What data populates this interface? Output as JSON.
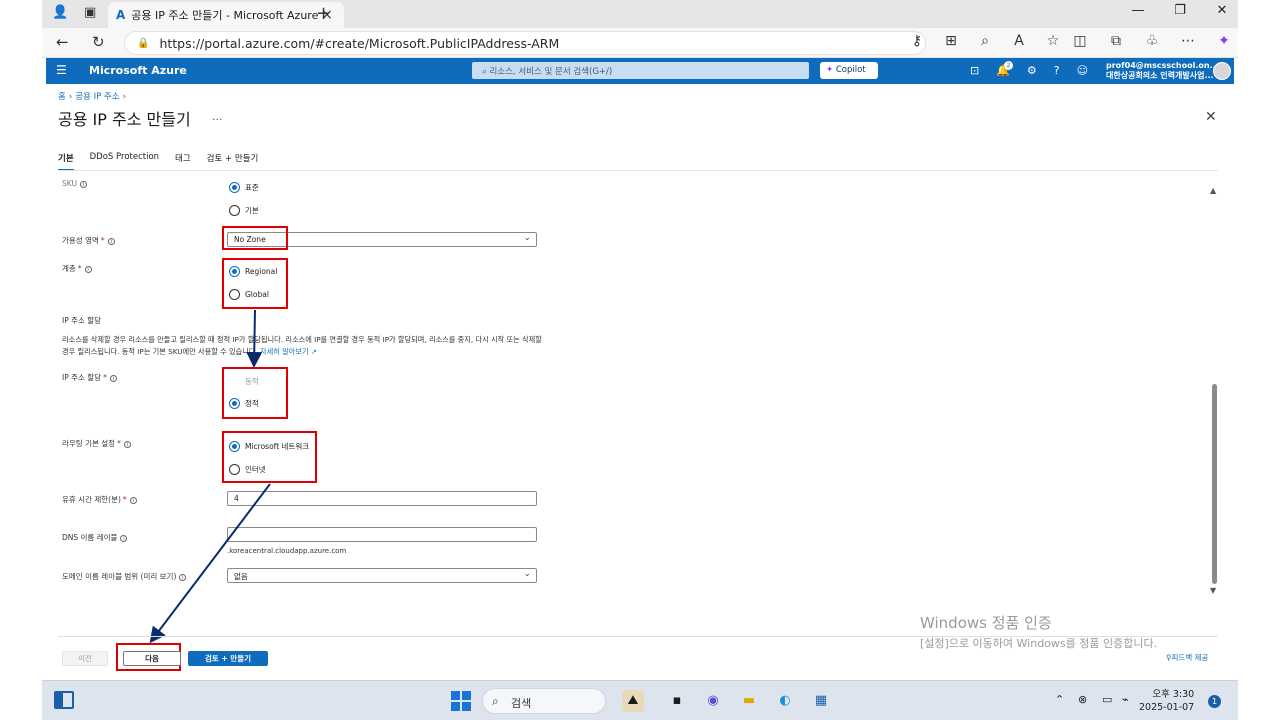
{
  "browser": {
    "tab_title": "공용 IP 주소 만들기 - Microsoft Azure",
    "url": "https://portal.azure.com/#create/Microsoft.PublicIPAddress-ARM"
  },
  "azure": {
    "brand": "Microsoft Azure",
    "search_placeholder": "리소스, 서비스 및 문서 검색(G+/)",
    "copilot": "Copilot",
    "notif_count": "2",
    "user_email": "prof04@mscsschool.on...",
    "user_org": "대한상공회의소 인력개발사업..."
  },
  "page": {
    "breadcrumb": [
      "홈",
      "공용 IP 주소"
    ],
    "title": "공용 IP 주소 만들기",
    "more": "...",
    "tabs": [
      "기본",
      "DDoS Protection",
      "태그",
      "검토 + 만들기"
    ]
  },
  "form": {
    "sku_label": "SKU",
    "sku_options": [
      "표준",
      "기본"
    ],
    "zone_label": "가용성 영역",
    "zone_value": "No Zone",
    "tier_label": "계층",
    "tier_options": [
      "Regional",
      "Global"
    ],
    "ip_assign_heading": "IP 주소 할당",
    "ip_assign_desc": "리소스를 삭제할 경우 리소스를 만들고 릴리스할 때 정적 IP가 할당됩니다. 리소스에 IP를 연결할 경우 동적 IP가 할당되며, 리소스를 중지, 다시 시작 또는 삭제할 경우 릴리스됩니다. 동적 IP는 기본 SKU에만 사용할 수 있습니다.",
    "learn_more": "자세히 알아보기",
    "ip_assign_label": "IP 주소 할당",
    "ip_assign_options": [
      "동적",
      "정적"
    ],
    "routing_label": "라우팅 기본 설정",
    "routing_options": [
      "Microsoft 네트워크",
      "인터넷"
    ],
    "idle_label": "유휴 시간 제한(분)",
    "idle_value": "4",
    "dns_label": "DNS 이름 레이블",
    "dns_value": "",
    "dns_suffix": ".koreacentral.cloudapp.azure.com",
    "domain_scope_label": "도메인 이름 레이블 범위 (미리 보기)",
    "domain_scope_value": "없음"
  },
  "footer": {
    "prev": "이전",
    "next": "다음",
    "review": "검토 + 만들기",
    "feedback": "피드백 제공"
  },
  "watermark": {
    "line1": "Windows 정품 인증",
    "line2": "[설정]으로 이동하여 Windows를 정품 인증합니다."
  },
  "taskbar": {
    "search": "검색",
    "time": "오후 3:30",
    "date": "2025-01-07",
    "notif": "1"
  },
  "colors": {
    "azure_blue": "#0f6cbd",
    "annotation_red": "#e00000",
    "arrow_navy": "#0a2a6b"
  }
}
